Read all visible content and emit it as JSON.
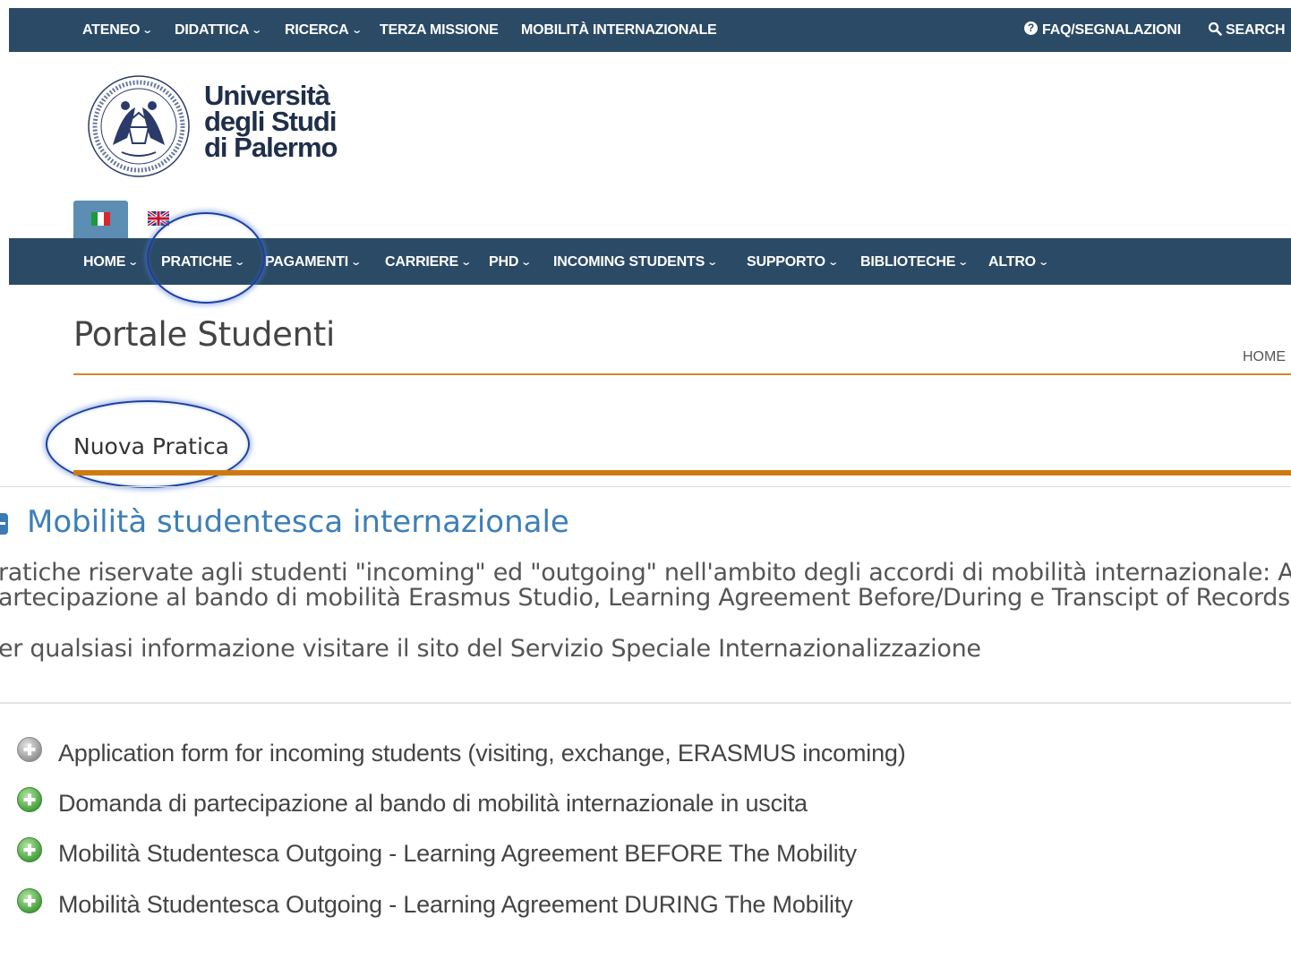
{
  "top_nav": {
    "items": [
      {
        "label": "ATENEO",
        "dropdown": true
      },
      {
        "label": "DIDATTICA",
        "dropdown": true
      },
      {
        "label": "RICERCA",
        "dropdown": true
      },
      {
        "label": "TERZA MISSIONE",
        "dropdown": false
      },
      {
        "label": "MOBILITÀ INTERNAZIONALE",
        "dropdown": false
      }
    ],
    "faq": "FAQ/SEGNALAZIONI",
    "search": "SEARCH"
  },
  "logo": {
    "line1": "Università",
    "line2": "degli Studi",
    "line3": "di Palermo",
    "seal_icon": "university-seal-icon"
  },
  "languages": {
    "selected": "it",
    "options": [
      "it-flag-icon",
      "uk-flag-icon"
    ]
  },
  "main_nav": {
    "items": [
      {
        "label": "HOME"
      },
      {
        "label": "PRATICHE"
      },
      {
        "label": "PAGAMENTI"
      },
      {
        "label": "CARRIERE"
      },
      {
        "label": "PHD"
      },
      {
        "label": "INCOMING STUDENTS"
      },
      {
        "label": "SUPPORTO"
      },
      {
        "label": "BIBLIOTECHE"
      },
      {
        "label": "ALTRO"
      }
    ]
  },
  "page": {
    "title": "Portale Studenti",
    "breadcrumb": "HOME",
    "subtitle": "Nuova Pratica"
  },
  "section": {
    "title": "Mobilità studentesca internazionale",
    "desc_line1": "ratiche riservate agli studenti \"incoming\" ed \"outgoing\" nell'ambito degli accordi di mobilità internazionale: App",
    "desc_line2": "artecipazione al bando di mobilità Erasmus Studio, Learning Agreement Before/During e Transcipt of Records",
    "desc_line3": "er qualsiasi informazione visitare il sito del Servizio Speciale Internazionalizzazione"
  },
  "practices": [
    {
      "label": "Application form for incoming students (visiting, exchange, ERASMUS incoming)",
      "state": "disabled"
    },
    {
      "label": "Domanda di partecipazione al bando di mobilità internazionale in uscita",
      "state": "available"
    },
    {
      "label": "Mobilità Studentesca Outgoing - Learning Agreement BEFORE The Mobility",
      "state": "available"
    },
    {
      "label": "Mobilità Studentesca Outgoing - Learning Agreement DURING The Mobility",
      "state": "available"
    }
  ],
  "colors": {
    "nav_bg": "#2b4a66",
    "accent_orange": "#cf7a10",
    "section_blue": "#3d7fb8",
    "lang_selected": "#5c8db3",
    "highlight": "#1b3fa0",
    "icon_green": "#5aaa4a",
    "icon_gray": "#a8a8a8"
  }
}
